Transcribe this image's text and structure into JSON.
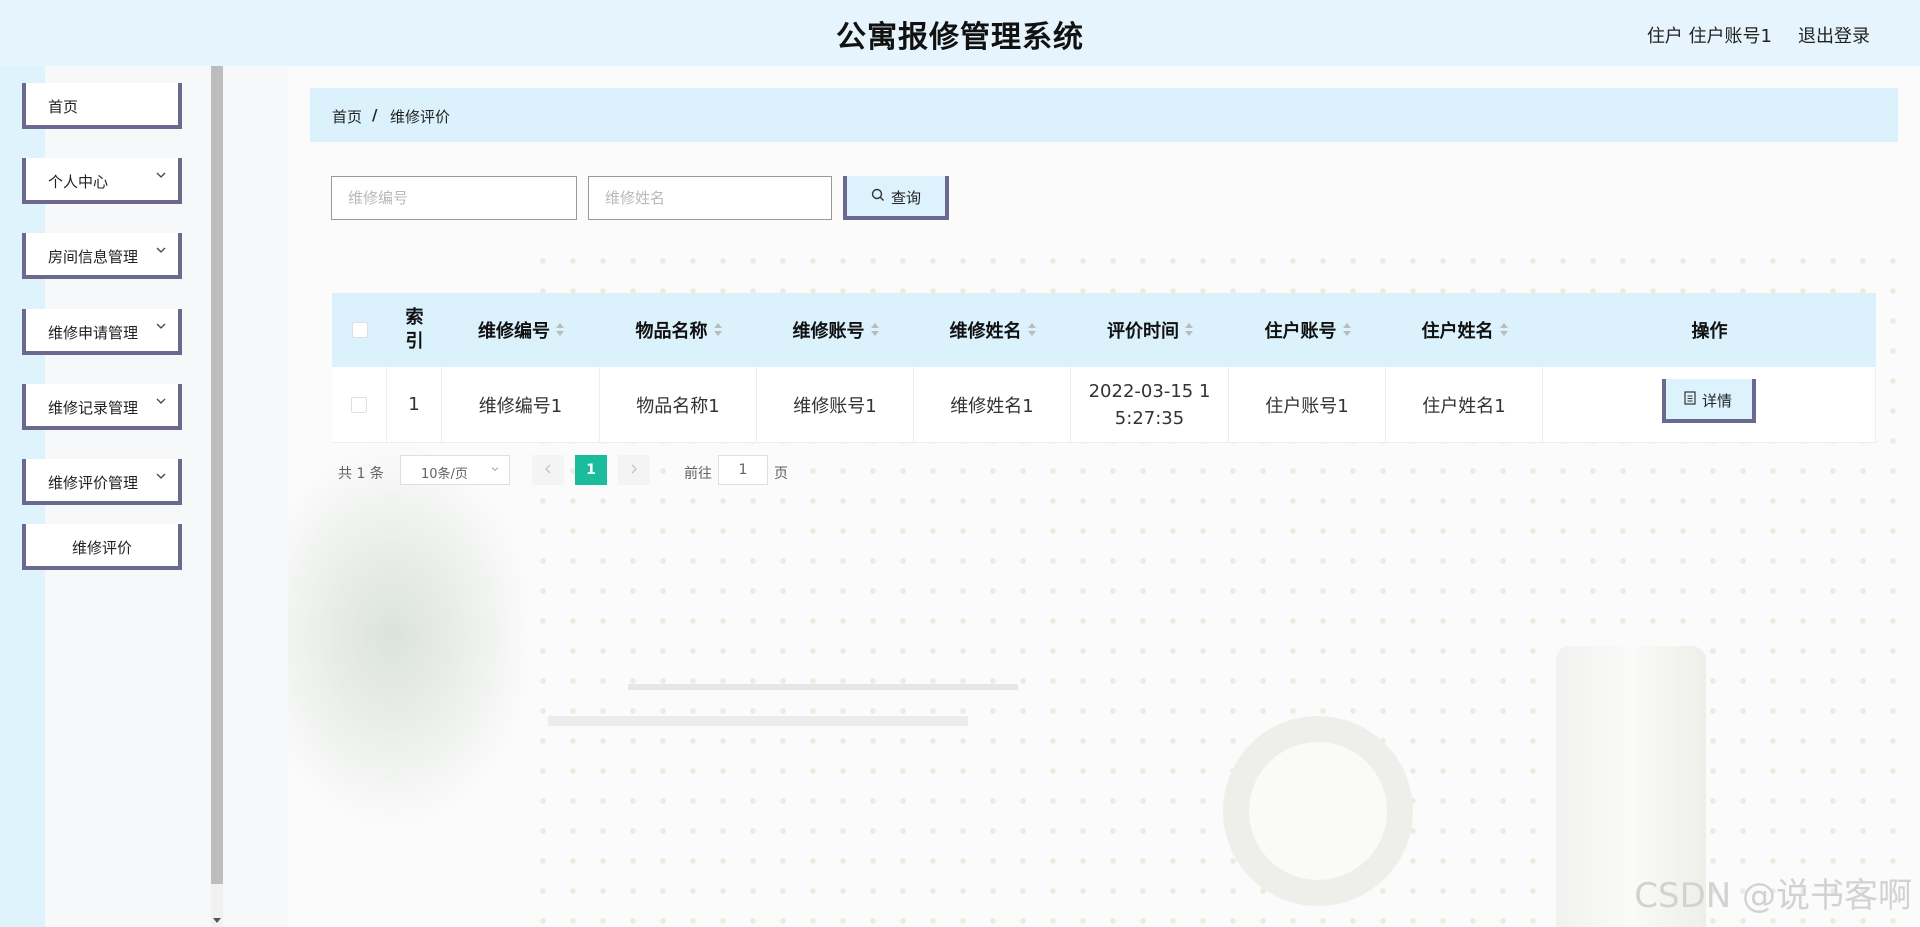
{
  "header": {
    "title": "公寓报修管理系统",
    "user": "住户 住户账号1",
    "logout": "退出登录"
  },
  "sidebar": {
    "items": [
      {
        "label": "首页",
        "expandable": false
      },
      {
        "label": "个人中心",
        "expandable": true
      },
      {
        "label": "房间信息管理",
        "expandable": true
      },
      {
        "label": "维修申请管理",
        "expandable": true
      },
      {
        "label": "维修记录管理",
        "expandable": true
      },
      {
        "label": "维修评价管理",
        "expandable": true
      }
    ],
    "sub_item": "维修评价"
  },
  "breadcrumb": {
    "home": "首页",
    "separator": "/",
    "current": "维修评价"
  },
  "search": {
    "repair_no_placeholder": "维修编号",
    "repair_name_placeholder": "维修姓名",
    "query_label": "查询"
  },
  "table": {
    "columns": [
      "索引",
      "维修编号",
      "物品名称",
      "维修账号",
      "维修姓名",
      "评价时间",
      "住户账号",
      "住户姓名",
      "操作"
    ],
    "rows": [
      {
        "index": "1",
        "repair_no": "维修编号1",
        "item_name": "物品名称1",
        "repair_account": "维修账号1",
        "repair_name": "维修姓名1",
        "eval_time": "2022-03-15 15:27:35",
        "resident_account": "住户账号1",
        "resident_name": "住户姓名1",
        "action_label": "详情"
      }
    ]
  },
  "pagination": {
    "total": "共 1 条",
    "page_size": "10条/页",
    "current_page": "1",
    "goto_label": "前往",
    "goto_value": "1",
    "page_unit": "页"
  },
  "watermark": "CSDN @说书客啊",
  "colors": {
    "accent_border": "#6b6a8e",
    "light_blue": "#dbf2fd",
    "active_page": "#1abc9c"
  }
}
